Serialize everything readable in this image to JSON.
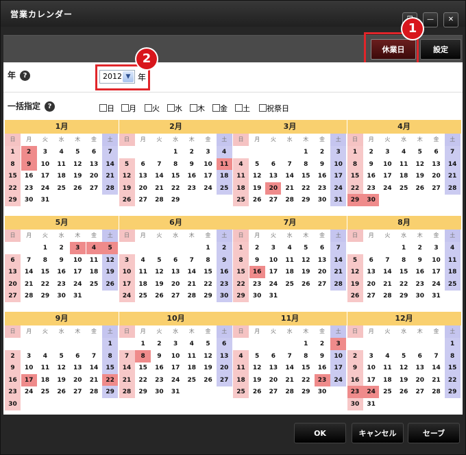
{
  "window": {
    "title": "営業カレンダー",
    "buttons": [
      "❐",
      "—",
      "✕"
    ]
  },
  "toolbar": {
    "holiday_label": "休業日",
    "settings_label": "設定"
  },
  "markers": [
    "1",
    "2"
  ],
  "year_row": {
    "label": "年",
    "help": "?",
    "year_value": "2012",
    "year_unit": "年"
  },
  "bulk_row": {
    "label": "一括指定",
    "help": "?",
    "options": [
      "日",
      "月",
      "火",
      "水",
      "木",
      "金",
      "土",
      "祝祭日"
    ]
  },
  "weekdays": [
    "日",
    "月",
    "火",
    "水",
    "木",
    "金",
    "土"
  ],
  "months": [
    {
      "name": "1月",
      "offset": 0,
      "days": 31,
      "holidays": [
        2,
        9
      ]
    },
    {
      "name": "2月",
      "offset": 3,
      "days": 29,
      "holidays": [
        11
      ]
    },
    {
      "name": "3月",
      "offset": 4,
      "days": 31,
      "holidays": [
        20
      ]
    },
    {
      "name": "4月",
      "offset": 0,
      "days": 30,
      "holidays": [
        29,
        30
      ]
    },
    {
      "name": "5月",
      "offset": 2,
      "days": 31,
      "holidays": [
        3,
        4,
        5
      ]
    },
    {
      "name": "6月",
      "offset": 5,
      "days": 30,
      "holidays": []
    },
    {
      "name": "7月",
      "offset": 0,
      "days": 31,
      "holidays": [
        16
      ]
    },
    {
      "name": "8月",
      "offset": 3,
      "days": 31,
      "holidays": []
    },
    {
      "name": "9月",
      "offset": 6,
      "days": 30,
      "holidays": [
        17,
        22
      ]
    },
    {
      "name": "10月",
      "offset": 1,
      "days": 31,
      "holidays": [
        8
      ]
    },
    {
      "name": "11月",
      "offset": 4,
      "days": 30,
      "holidays": [
        3,
        23
      ]
    },
    {
      "name": "12月",
      "offset": 6,
      "days": 31,
      "holidays": [
        23,
        24
      ]
    }
  ],
  "footer": {
    "ok": "OK",
    "cancel": "キャンセル",
    "save": "セーブ"
  },
  "colors": {
    "header": "#f9d06f",
    "sunday": "#f7c8c8",
    "saturday": "#cbcbf1",
    "holiday": "#ef8b8b",
    "highlight": "#e0252a"
  }
}
